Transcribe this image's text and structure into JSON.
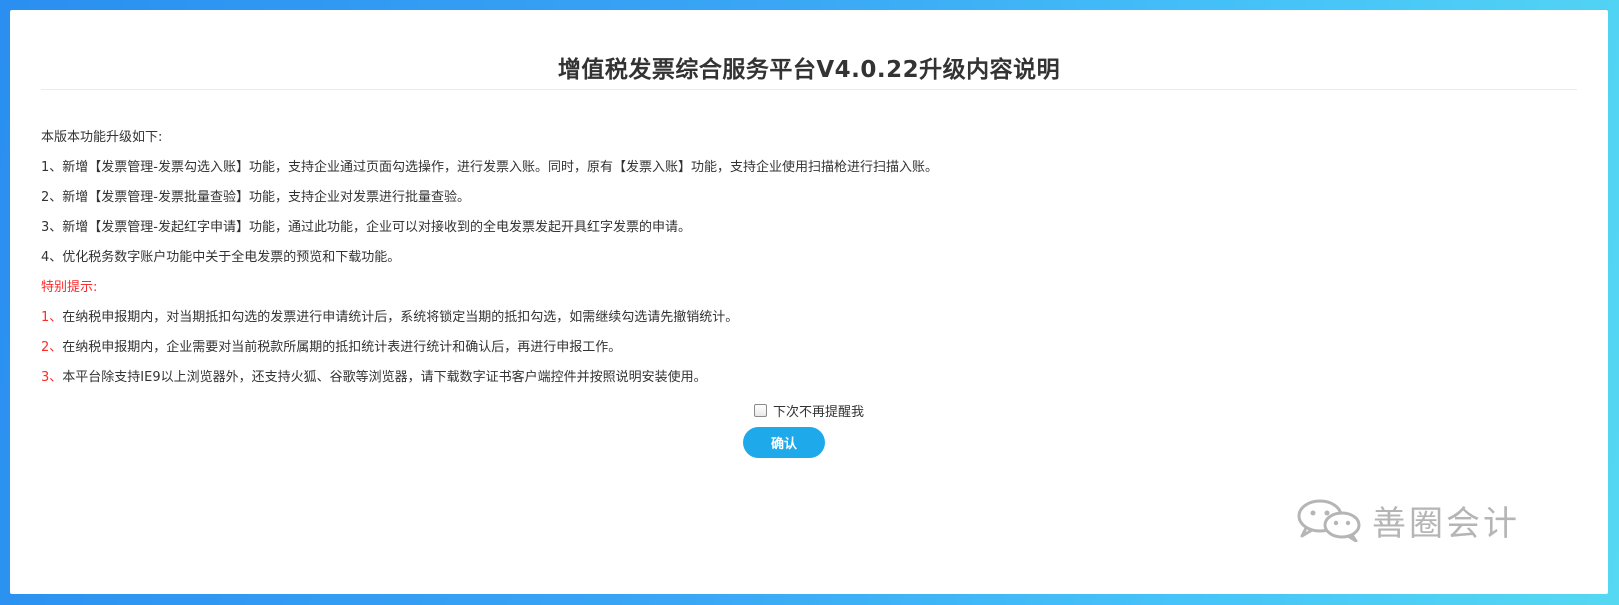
{
  "dialog": {
    "title": "增值税发票综合服务平台V4.0.22升级内容说明",
    "intro": "本版本功能升级如下:",
    "features": [
      "1、新增【发票管理-发票勾选入账】功能，支持企业通过页面勾选操作，进行发票入账。同时，原有【发票入账】功能，支持企业使用扫描枪进行扫描入账。",
      "2、新增【发票管理-发票批量查验】功能，支持企业对发票进行批量查验。",
      "3、新增【发票管理-发起红字申请】功能，通过此功能，企业可以对接收到的全电发票发起开具红字发票的申请。",
      "4、优化税务数字账户功能中关于全电发票的预览和下载功能。"
    ],
    "notice_label": "特别提示:",
    "notices": [
      {
        "num": "1、",
        "text": "在纳税申报期内，对当期抵扣勾选的发票进行申请统计后，系统将锁定当期的抵扣勾选，如需继续勾选请先撤销统计。"
      },
      {
        "num": "2、",
        "text": "在纳税申报期内，企业需要对当前税款所属期的抵扣统计表进行统计和确认后，再进行申报工作。"
      },
      {
        "num": "3、",
        "text": "本平台除支持IE9以上浏览器外，还支持火狐、谷歌等浏览器，请下载数字证书客户端控件并按照说明安装使用。"
      }
    ],
    "remind_label": "下次不再提醒我",
    "remind_checked": false,
    "confirm_label": "确认"
  },
  "watermark": {
    "icon": "wechat-icon",
    "text": "善圈会计"
  },
  "colors": {
    "accent": "#1ea9ea",
    "notice_red": "#ff2a2a",
    "text": "#333333"
  }
}
